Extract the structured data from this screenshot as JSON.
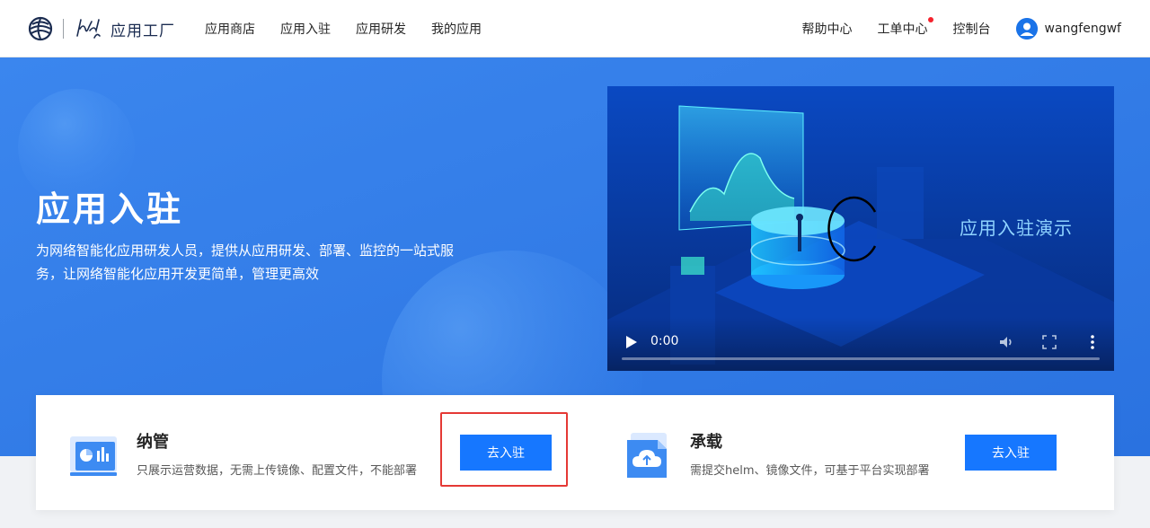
{
  "header": {
    "logo_text": "应用工厂",
    "nav_left": [
      "应用商店",
      "应用入驻",
      "应用研发",
      "我的应用"
    ],
    "nav_right": [
      "帮助中心",
      "工单中心",
      "控制台"
    ],
    "username": "wangfengwf"
  },
  "hero": {
    "title": "应用入驻",
    "description": "为网络智能化应用研发人员，提供从应用研发、部署、监控的一站式服务，让网络智能化应用开发更简单，管理更高效"
  },
  "video": {
    "caption": "应用入驻演示",
    "time": "0:00"
  },
  "cards": [
    {
      "title": "纳管",
      "description": "只展示运营数据，无需上传镜像、配置文件，不能部署",
      "button": "去入驻",
      "icon": "chart-board-icon"
    },
    {
      "title": "承载",
      "description": "需提交helm、镜像文件，可基于平台实现部署",
      "button": "去入驻",
      "icon": "cloud-upload-icon"
    }
  ],
  "colors": {
    "primary": "#1677ff",
    "hero_bg": "#2f7de8",
    "highlight": "#e53935",
    "notification": "#f5222d"
  }
}
